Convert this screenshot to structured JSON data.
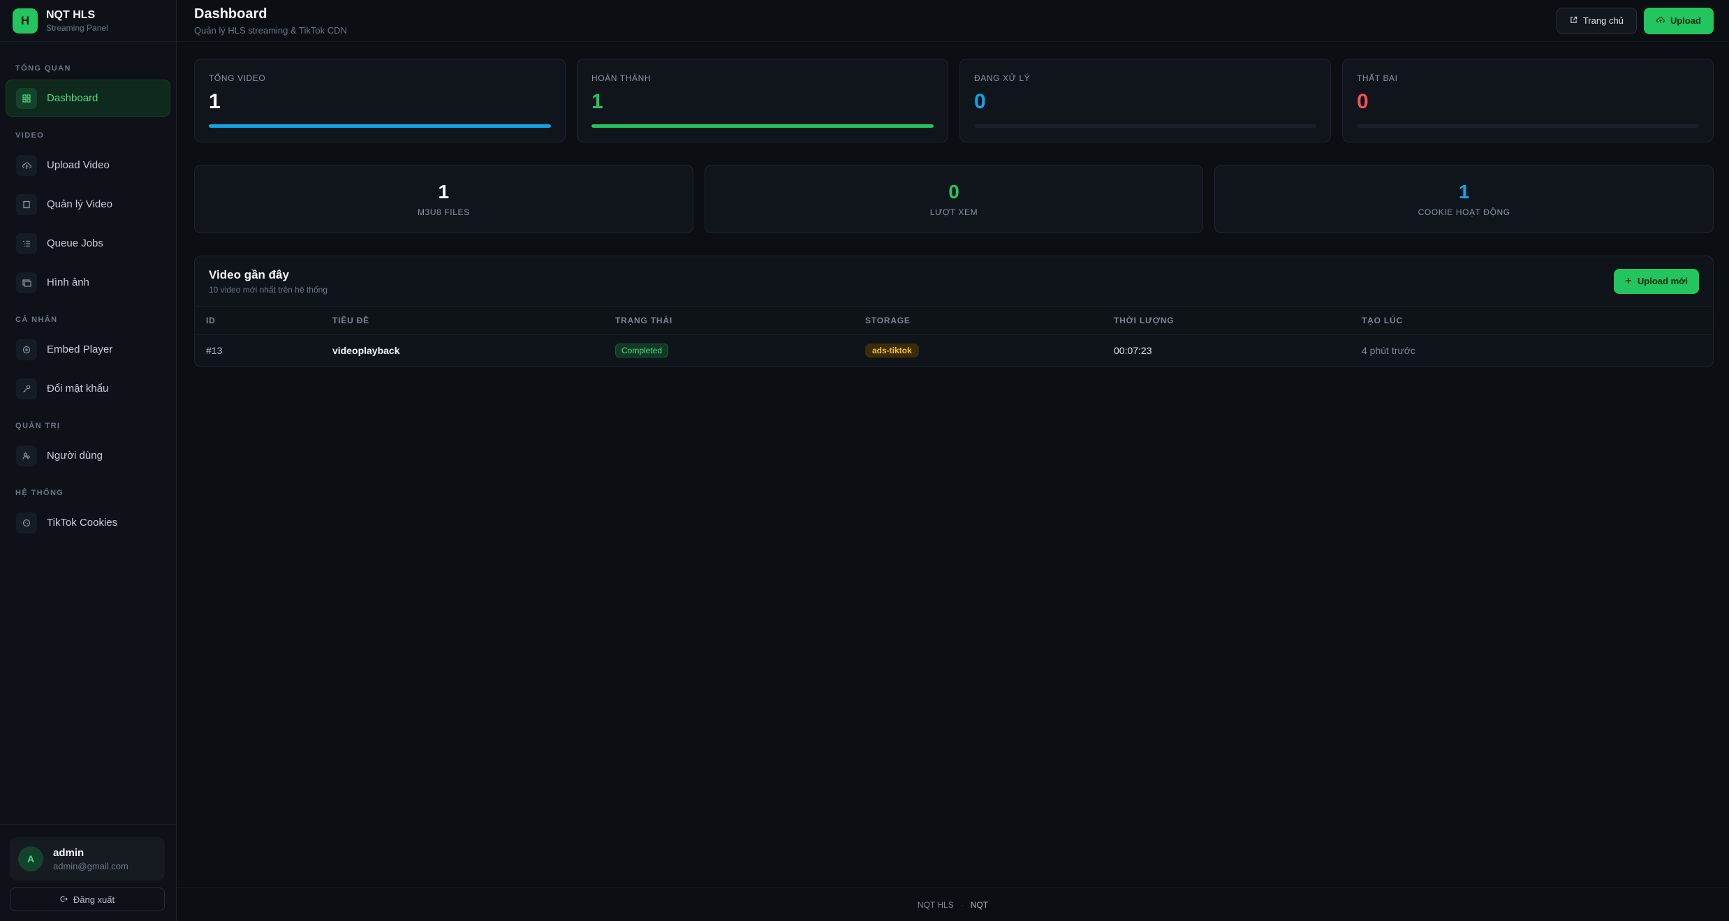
{
  "brand": {
    "logo_letter": "H",
    "name": "NQT HLS",
    "subtitle": "Streaming Panel"
  },
  "sidebar": {
    "sections": [
      {
        "label": "TỔNG QUAN"
      },
      {
        "label": "VIDEO"
      },
      {
        "label": "CÁ NHÂN"
      },
      {
        "label": "QUẢN TRỊ"
      },
      {
        "label": "HỆ THỐNG"
      }
    ],
    "items": [
      {
        "label": "Dashboard",
        "icon": "grid-icon",
        "active": true
      },
      {
        "label": "Upload Video",
        "icon": "cloud-upload-icon"
      },
      {
        "label": "Quản lý Video",
        "icon": "square-icon"
      },
      {
        "label": "Queue Jobs",
        "icon": "list-icon"
      },
      {
        "label": "Hình ảnh",
        "icon": "image-icon"
      },
      {
        "label": "Embed Player",
        "icon": "target-icon"
      },
      {
        "label": "Đổi mật khẩu",
        "icon": "key-icon"
      },
      {
        "label": "Người dùng",
        "icon": "users-icon"
      },
      {
        "label": "TikTok Cookies",
        "icon": "cookie-icon"
      }
    ],
    "user": {
      "avatar_letter": "A",
      "name": "admin",
      "email": "admin@gmail.com"
    },
    "logout_label": "Đăng xuất"
  },
  "header": {
    "title": "Dashboard",
    "subtitle": "Quản lý HLS streaming & TikTok CDN",
    "home_label": "Trang chủ",
    "upload_label": "Upload"
  },
  "stats": [
    {
      "label": "TỔNG VIDEO",
      "value": "1",
      "color": "#ffffff",
      "bar_color": "#0ea5e9",
      "fill": 1.0
    },
    {
      "label": "HOÀN THÀNH",
      "value": "1",
      "color": "#22c55e",
      "bar_color": "#22c55e",
      "fill": 1.0
    },
    {
      "label": "ĐANG XỬ LÝ",
      "value": "0",
      "color": "#0ea5e9",
      "bar_color": "#0ea5e9",
      "fill": 0
    },
    {
      "label": "THẤT BẠI",
      "value": "0",
      "color": "#f05252",
      "bar_color": "#f05252",
      "fill": 0
    }
  ],
  "metrics": [
    {
      "label": "M3U8 FILES",
      "value": "1",
      "color": "#ffffff"
    },
    {
      "label": "LƯỢT XEM",
      "value": "0",
      "color": "#22c55e"
    },
    {
      "label": "COOKIE HOẠT ĐỘNG",
      "value": "1",
      "color": "#0ea5e9"
    }
  ],
  "recent": {
    "title": "Video gần đây",
    "subtitle": "10 video mới nhất trên hệ thống",
    "upload_new_label": "Upload mới",
    "columns": [
      "ID",
      "TIÊU ĐỀ",
      "TRẠNG THÁI",
      "STORAGE",
      "THỜI LƯỢNG",
      "TẠO LÚC"
    ],
    "rows": [
      {
        "id": "#13",
        "title": "videoplayback",
        "status": "Completed",
        "storage": "ads-tiktok",
        "duration": "00:07:23",
        "created": "4 phút trước"
      }
    ]
  },
  "footer": {
    "left": "NQT HLS",
    "sep": "·",
    "right": "NQT"
  }
}
